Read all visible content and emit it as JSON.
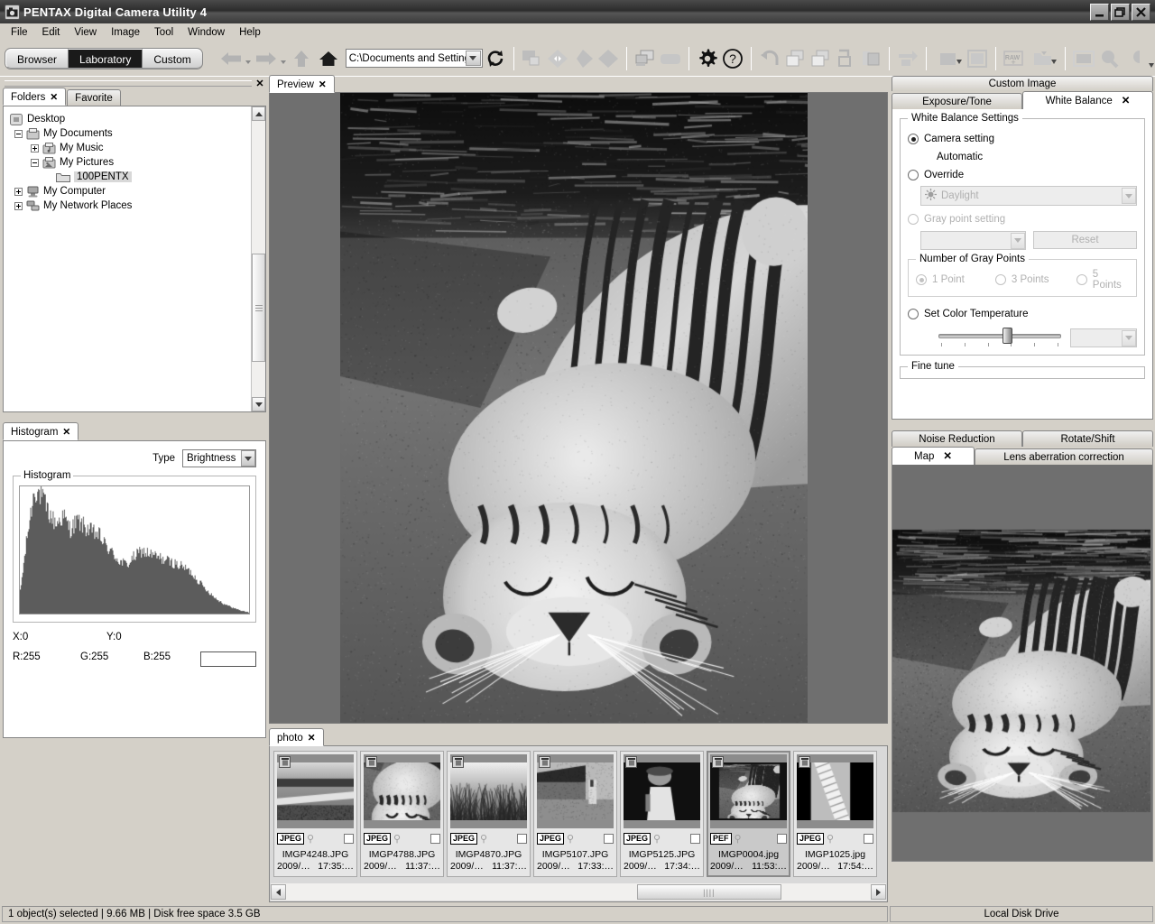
{
  "window": {
    "title": "PENTAX Digital Camera Utility 4",
    "app_icon": "camera-icon",
    "minimize_label": "_",
    "restore_label": "❐",
    "close_label": "✕"
  },
  "menu": {
    "items": [
      "File",
      "Edit",
      "View",
      "Image",
      "Tool",
      "Window",
      "Help"
    ]
  },
  "toolbar": {
    "modes": [
      {
        "label": "Browser",
        "active": false
      },
      {
        "label": "Laboratory",
        "active": true
      },
      {
        "label": "Custom",
        "active": false
      }
    ],
    "path_value": "C:\\Documents and Setting",
    "icons": [
      "back-arrow-icon",
      "back-dropdown-icon",
      "forward-arrow-icon",
      "forward-dropdown-icon",
      "up-arrow-icon",
      "home-icon",
      "refresh-icon",
      "compare-icon",
      "before-after-icon",
      "prev-shape-icon",
      "next-shape-icon",
      "dual-display-icon",
      "slideshow-icon",
      "settings-gear-icon",
      "help-icon",
      "undo-icon",
      "copy-settings-icon",
      "paste-settings-icon",
      "save-as-icon",
      "batch-icon",
      "transfer-icon",
      "resize-icon",
      "crop-icon",
      "raw-plus-icon",
      "folder-out-icon",
      "fit-window-icon",
      "zoom-icon",
      "zoom-level-icon"
    ]
  },
  "left_panel": {
    "tabs": [
      {
        "label": "Folders",
        "active": true,
        "closable": true
      },
      {
        "label": "Favorite",
        "active": false,
        "closable": false
      }
    ],
    "tree": [
      {
        "label": "Desktop",
        "depth": 0,
        "toggle": "none",
        "icon": "desktop-icon",
        "selected": false
      },
      {
        "label": "My Documents",
        "depth": 1,
        "toggle": "minus",
        "icon": "folder-docs-icon",
        "selected": false
      },
      {
        "label": "My Music",
        "depth": 2,
        "toggle": "plus",
        "icon": "folder-music-icon",
        "selected": false
      },
      {
        "label": "My Pictures",
        "depth": 2,
        "toggle": "minus",
        "icon": "folder-pics-icon",
        "selected": false
      },
      {
        "label": "100PENTX",
        "depth": 3,
        "toggle": "none",
        "icon": "folder-icon",
        "selected": true
      },
      {
        "label": "My Computer",
        "depth": 1,
        "toggle": "plus",
        "icon": "computer-icon",
        "selected": false
      },
      {
        "label": "My Network Places",
        "depth": 1,
        "toggle": "plus",
        "icon": "network-icon",
        "selected": false
      }
    ],
    "histogram_tab": {
      "label": "Histogram",
      "closable": true
    },
    "histogram": {
      "type_label": "Type",
      "type_value": "Brightness",
      "group_label": "Histogram",
      "x_label": "X:0",
      "y_label": "Y:0",
      "r_label": "R:255",
      "g_label": "G:255",
      "b_label": "B:255"
    }
  },
  "center": {
    "tab": {
      "label": "Preview",
      "closable": true
    }
  },
  "filmstrip": {
    "tab": {
      "label": "photo",
      "closable": true
    },
    "items": [
      {
        "name": "IMGP4248.JPG",
        "format": "JPEG",
        "date": "2009/…",
        "time": "17:35:…",
        "selected": false,
        "scene": "road"
      },
      {
        "name": "IMGP4788.JPG",
        "format": "JPEG",
        "date": "2009/…",
        "time": "11:37:…",
        "selected": false,
        "scene": "tiger-head"
      },
      {
        "name": "IMGP4870.JPG",
        "format": "JPEG",
        "date": "2009/…",
        "time": "11:37:…",
        "selected": false,
        "scene": "grass"
      },
      {
        "name": "IMGP5107.JPG",
        "format": "JPEG",
        "date": "2009/…",
        "time": "17:33:…",
        "selected": false,
        "scene": "hut"
      },
      {
        "name": "IMGP5125.JPG",
        "format": "JPEG",
        "date": "2009/…",
        "time": "17:34:…",
        "selected": false,
        "scene": "portrait"
      },
      {
        "name": "IMGP0004.jpg",
        "format": "PEF",
        "date": "2009/…",
        "time": "11:53:…",
        "selected": true,
        "scene": "tiger-lying"
      },
      {
        "name": "IMGP1025.jpg",
        "format": "JPEG",
        "date": "2009/…",
        "time": "17:54:…",
        "selected": false,
        "scene": "arm"
      }
    ]
  },
  "right_panel": {
    "custom_image_tab": "Custom Image",
    "tabs": [
      {
        "label": "Exposure/Tone",
        "active": false,
        "closable": false
      },
      {
        "label": "White Balance",
        "active": true,
        "closable": true
      }
    ],
    "white_balance": {
      "group_label": "White Balance Settings",
      "camera_setting_label": "Camera setting",
      "camera_setting_value": "Automatic",
      "camera_setting_checked": true,
      "override_label": "Override",
      "override_checked": false,
      "override_value": "Daylight",
      "override_icon": "sun-icon",
      "gray_point_label": "Gray point setting",
      "gray_point_checked": false,
      "gray_point_value": "",
      "reset_label": "Reset",
      "gray_points_group_label": "Number of Gray Points",
      "gray_points_options": [
        {
          "label": "1 Point",
          "checked": true
        },
        {
          "label": "3 Points",
          "checked": false
        },
        {
          "label": "5 Points",
          "checked": false
        }
      ],
      "color_temp_label": "Set Color Temperature",
      "color_temp_checked": false,
      "color_temp_value": "",
      "fine_tune_label": "Fine tune"
    },
    "lower_tabs_row1": [
      {
        "label": "Noise Reduction",
        "active": false
      },
      {
        "label": "Rotate/Shift",
        "active": false
      }
    ],
    "lower_tabs_row2": [
      {
        "label": "Map",
        "active": true,
        "closable": true
      },
      {
        "label": "Lens aberration correction",
        "active": false,
        "closable": false
      }
    ]
  },
  "statusbar": {
    "left_text": "1 object(s) selected | 9.66 MB | Disk free space 3.5 GB",
    "right_text": "Local Disk Drive"
  },
  "colors": {
    "chrome": "#d4d0c8",
    "panel_bg": "#ffffff",
    "preview_bg": "#6f6f6f",
    "accent_dark": "#1a1a1a",
    "border": "#868686"
  },
  "chart_data": {
    "type": "bar",
    "title": "Histogram",
    "xlabel": "",
    "ylabel": "",
    "legend": [
      "Brightness"
    ],
    "grid": false,
    "xlim": [
      0,
      255
    ],
    "ylim": [
      0,
      100
    ],
    "categories": [
      "0",
      "8",
      "16",
      "24",
      "32",
      "40",
      "48",
      "56",
      "64",
      "72",
      "80",
      "88",
      "96",
      "104",
      "112",
      "120",
      "128",
      "136",
      "144",
      "152",
      "160",
      "168",
      "176",
      "184",
      "192",
      "200",
      "208",
      "216",
      "224",
      "232",
      "240",
      "248",
      "255"
    ],
    "values": [
      16,
      58,
      92,
      86,
      74,
      66,
      72,
      62,
      68,
      64,
      60,
      58,
      50,
      44,
      38,
      36,
      42,
      46,
      44,
      42,
      40,
      38,
      36,
      34,
      30,
      24,
      18,
      13,
      9,
      6,
      4,
      2,
      1
    ]
  }
}
